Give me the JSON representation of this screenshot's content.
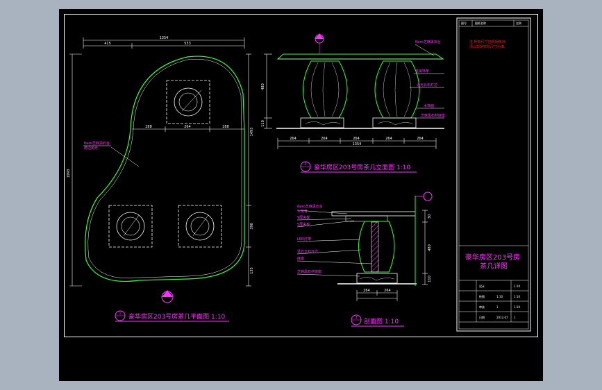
{
  "colors": {
    "background": "#000000",
    "outline": "#ffffff",
    "green": "#33ff33",
    "magenta": "#ff33ff",
    "red": "#ff2020",
    "gray": "#a9b3bf"
  },
  "views": {
    "plan": {
      "number": "1",
      "title": "豪华房区203号房茶几平面图 1:10",
      "dims_top": [
        "1354",
        "415",
        "533"
      ],
      "dims_mid": [
        "288",
        "264",
        "288"
      ],
      "dims_left": [
        "1993"
      ],
      "dims_right": [
        "1493",
        "390",
        "135"
      ],
      "material_note": "Nero芝麻黑石台\n磨边抛光"
    },
    "elevation": {
      "number": "2",
      "title": "豪华房区203号房茶几立面图 1:10",
      "dims_bottom": [
        "264",
        "264",
        "264",
        "264",
        "264"
      ],
      "dims_total": "1354",
      "dims_side": [
        "480",
        "110"
      ],
      "callouts": [
        "Nero芝麻黑石台",
        "金属饰条",
        "透光云石灯芯",
        "木饰面",
        "芝麻黑石材底座"
      ]
    },
    "section": {
      "number": "3",
      "title": "剖面图 1:10",
      "dims_bottom": [
        "264",
        "264"
      ],
      "dims_side": [
        "30",
        "480",
        "110"
      ],
      "callouts": [
        "Nero芝麻黑石台",
        "木龙骨",
        "9厘夹板",
        "5厘夹板",
        "LED灯带",
        "透光云石灯芯",
        "底座",
        "芝麻黑石材底座"
      ]
    }
  },
  "title_block": {
    "header_cells": [
      "图号",
      "图纸名称",
      "比例"
    ],
    "note": "注:所有尺寸应现场核对\n须以现场实际尺寸为准。",
    "project_title": "豪华房区203号房\n茶几详图",
    "rows": [
      [
        "",
        "设计",
        "",
        "1:10"
      ],
      [
        "",
        "绘图",
        "1:10",
        "1:10"
      ],
      [
        "",
        "审核",
        "1",
        "1:10"
      ],
      [
        "",
        "日期",
        "2012.07",
        "1"
      ]
    ]
  }
}
